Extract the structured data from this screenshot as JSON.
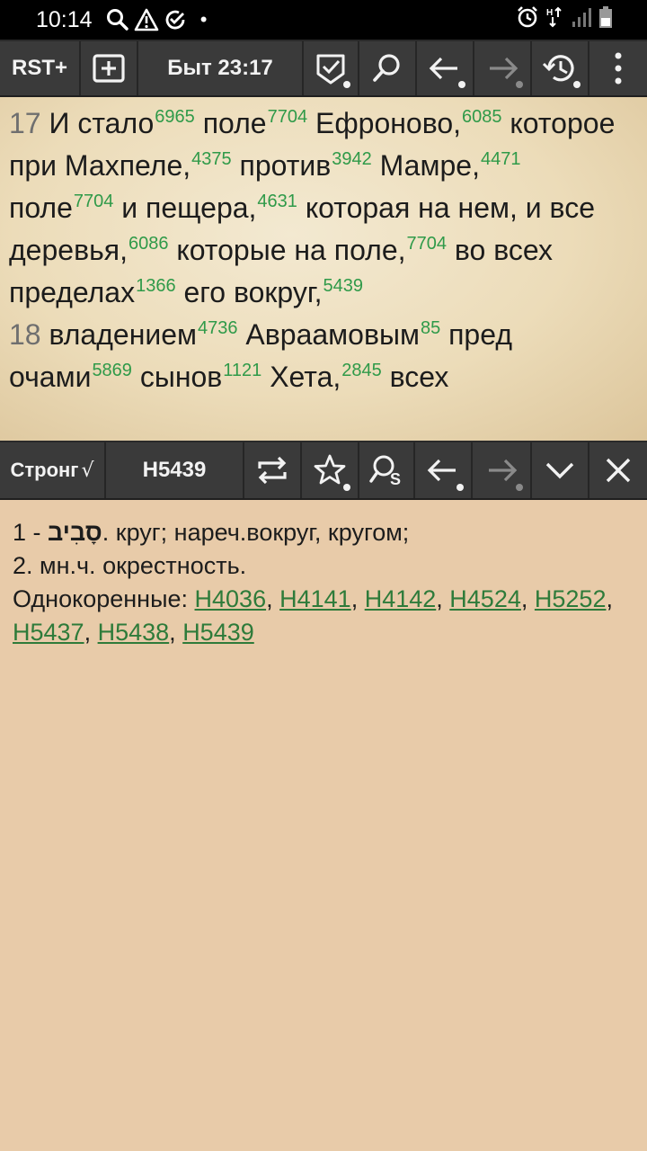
{
  "status_bar": {
    "time": "10:14",
    "left_icons": [
      "search-icon",
      "warning-icon",
      "check-circle-icon",
      "dot-icon"
    ],
    "right_icons": [
      "alarm-icon",
      "data-arrows-icon",
      "signal-icon",
      "battery-icon"
    ],
    "dot": "•"
  },
  "top_toolbar": {
    "module": "RST+",
    "reference": "Быт 23:17"
  },
  "verses": [
    {
      "number": "17",
      "segments": [
        {
          "t": "И стало",
          "s": "6965"
        },
        {
          "t": " поле",
          "s": "7704"
        },
        {
          "t": " Ефроново,",
          "s": "6085"
        },
        {
          "t": " которое при Махпеле,",
          "s": "4375"
        },
        {
          "t": " против",
          "s": "3942"
        },
        {
          "t": " Мамре,",
          "s": "4471"
        },
        {
          "t": " поле",
          "s": "7704"
        },
        {
          "t": " и пещера,",
          "s": "4631"
        },
        {
          "t": " которая на нем, и все деревья,",
          "s": "6086"
        },
        {
          "t": " которые на поле,",
          "s": "7704"
        },
        {
          "t": " во всех пределах",
          "s": "1366"
        },
        {
          "t": " его вокруг,",
          "s": "5439"
        }
      ]
    },
    {
      "number": "18",
      "segments": [
        {
          "t": "владением",
          "s": "4736"
        },
        {
          "t": " Авраамовым",
          "s": "85"
        },
        {
          "t": " пред очами",
          "s": "5869"
        },
        {
          "t": " сынов",
          "s": "1121"
        },
        {
          "t": " Хета,",
          "s": "2845"
        },
        {
          "t": " всех",
          "s": ""
        }
      ]
    }
  ],
  "strong_toolbar": {
    "label": "Стронг",
    "check": "√",
    "code": "H5439"
  },
  "definition": {
    "line1_prefix": "1 - ",
    "hebrew": "סָבִיב",
    "line1_suffix": ". круг; нареч.вокруг, кругом;",
    "line2": "2. мн.ч. окрестность.",
    "related_label": "Однокоренные:",
    "related": [
      "H4036",
      "H4141",
      "H4142",
      "H4524",
      "H5252",
      "H5437",
      "H5438",
      "H5439"
    ]
  },
  "colors": {
    "toolbar": "#3a3a3a",
    "strong_number": "#2f9a49",
    "link": "#2e7b3a",
    "definition_bg": "#e8cba9"
  }
}
